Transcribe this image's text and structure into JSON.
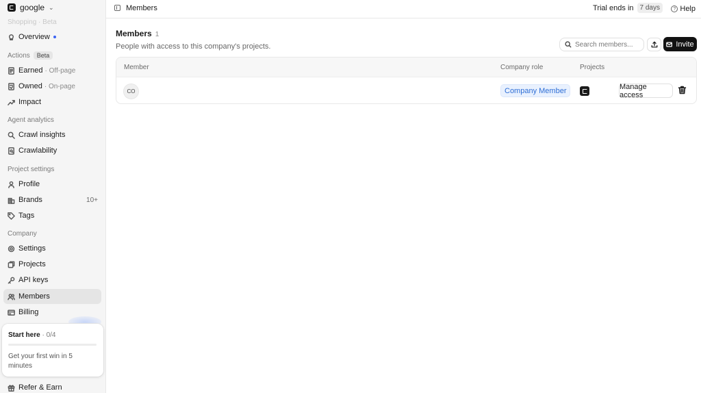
{
  "workspace": {
    "name": "google"
  },
  "ghost_label": "Shopping · Beta",
  "sidebar": {
    "overview": {
      "label": "Overview",
      "icon": "bulb-icon"
    },
    "sections": {
      "actions": {
        "label": "Actions",
        "badge": "Beta"
      },
      "agent": {
        "label": "Agent analytics"
      },
      "project": {
        "label": "Project settings"
      },
      "company": {
        "label": "Company"
      }
    },
    "items": {
      "earned": {
        "label": "Earned",
        "sub": "· Off-page"
      },
      "owned": {
        "label": "Owned",
        "sub": "· On-page"
      },
      "impact": {
        "label": "Impact"
      },
      "crawl": {
        "label": "Crawl insights"
      },
      "crawlability": {
        "label": "Crawlability"
      },
      "profile": {
        "label": "Profile"
      },
      "brands": {
        "label": "Brands",
        "count": "10+"
      },
      "tags": {
        "label": "Tags"
      },
      "settings": {
        "label": "Settings"
      },
      "projects": {
        "label": "Projects"
      },
      "apikeys": {
        "label": "API keys"
      },
      "members": {
        "label": "Members"
      },
      "billing": {
        "label": "Billing"
      },
      "refer": {
        "label": "Refer & Earn"
      }
    },
    "start_card": {
      "title": "Start here",
      "count": "· 0/4",
      "progress": 0,
      "text": "Get your first win in 5 minutes"
    }
  },
  "topbar": {
    "title": "Members",
    "trial_label": "Trial ends in",
    "trial_days": "7 days",
    "help_label": "Help"
  },
  "main": {
    "title": "Members",
    "count": "1",
    "description": "People with access to this company's projects.",
    "search_placeholder": "Search members...",
    "invite_label": "Invite",
    "table": {
      "headers": {
        "member": "Member",
        "role": "Company role",
        "projects": "Projects"
      },
      "rows": [
        {
          "initials": "CO",
          "role": "Company Member",
          "manage_label": "Manage access"
        }
      ]
    }
  },
  "colors": {
    "accent_blue": "#3b63f3",
    "role_badge_text": "#2f6fd6",
    "invite_bg": "#121212"
  }
}
